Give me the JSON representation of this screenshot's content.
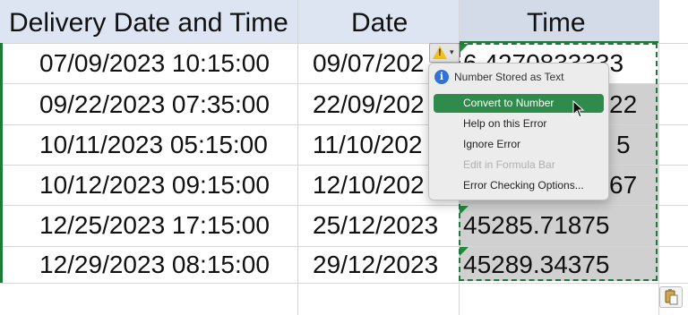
{
  "headers": {
    "col_a": "Delivery Date and Time",
    "col_b": "Date",
    "col_c": "Time"
  },
  "rows": [
    {
      "a": "07/09/2023 10:15:00",
      "b": "09/07/2023",
      "c": "6.42708333333",
      "c_shown": "6.4270833333"
    },
    {
      "a": "09/22/2023 07:35:00",
      "b": "22/09/2023",
      "c_shown": "22"
    },
    {
      "a": "10/11/2023 05:15:00",
      "b": "11/10/2023",
      "c_shown": "5"
    },
    {
      "a": "10/12/2023 09:15:00",
      "b": "12/10/2023",
      "c_shown": "67"
    },
    {
      "a": "12/25/2023 17:15:00",
      "b": "25/12/2023",
      "c_shown": "45285.71875"
    },
    {
      "a": "12/29/2023 08:15:00",
      "b": "29/12/2023",
      "c_shown": "45289.34375"
    }
  ],
  "visible_b": [
    "09/07/202",
    "22/09/202",
    "11/10/202",
    "12/10/202",
    "25/12/2023",
    "29/12/2023"
  ],
  "error_menu": {
    "header": "Number Stored as Text",
    "items": [
      {
        "label": "Convert to Number",
        "state": "active"
      },
      {
        "label": "Help on this Error",
        "state": "normal"
      },
      {
        "label": "Ignore Error",
        "state": "normal"
      },
      {
        "label": "Edit in Formula Bar",
        "state": "disabled"
      },
      {
        "label": "Error Checking Options...",
        "state": "normal"
      }
    ]
  },
  "icons": {
    "warning": "warning-icon",
    "info": "info-icon",
    "paste": "paste-options-icon",
    "cursor": "mouse-pointer-icon"
  },
  "colors": {
    "header_bg": "#dde5f3",
    "selection_green": "#1f7a3a",
    "menu_active": "#2e8b4c",
    "selected_cell_bg": "#d0d0d0"
  }
}
